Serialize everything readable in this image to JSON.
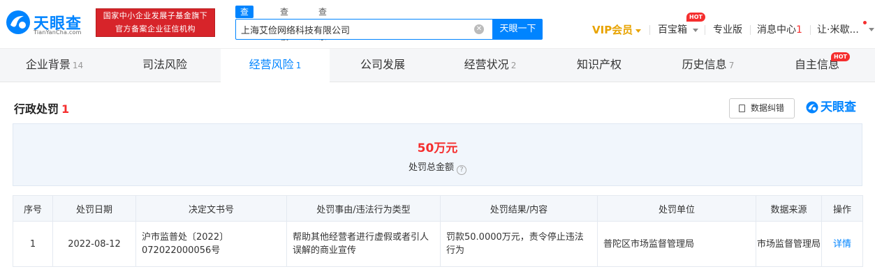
{
  "header": {
    "logo_text": "天眼查",
    "logo_sub": "TianYanCha.com",
    "banner_line1": "国家中小企业发展子基金旗下",
    "banner_line2": "官方备案企业征信机构",
    "search_tabs": [
      "查公司",
      "查老板",
      "查关系"
    ],
    "search_value": "上海艾俭网络科技有限公司",
    "search_button": "天眼一下",
    "vip_label": "VIP会员",
    "treasure_label": "百宝箱",
    "hot_badge": "HOT",
    "pro_label": "专业版",
    "msg_label": "消息中心",
    "msg_count": "1",
    "user_label": "让·米歇..."
  },
  "tabs": [
    {
      "label": "企业背景",
      "count": "14"
    },
    {
      "label": "司法风险",
      "count": ""
    },
    {
      "label": "经营风险",
      "count": "1"
    },
    {
      "label": "公司发展",
      "count": ""
    },
    {
      "label": "经营状况",
      "count": "2"
    },
    {
      "label": "知识产权",
      "count": ""
    },
    {
      "label": "历史信息",
      "count": "7"
    },
    {
      "label": "自主信息",
      "count": ""
    }
  ],
  "tabs_hot_badge": "HOT",
  "section": {
    "title": "行政处罚",
    "count": "1",
    "report_button": "数据纠错",
    "watermark": "天眼查",
    "total_value": "50万元",
    "total_label": "处罚总金额",
    "help_glyph": "?"
  },
  "table": {
    "headers": [
      "序号",
      "处罚日期",
      "决定文书号",
      "处罚事由/违法行为类型",
      "处罚结果/内容",
      "处罚单位",
      "数据来源",
      "操作"
    ],
    "rows": [
      {
        "index": "1",
        "date": "2022-08-12",
        "doc_no": "沪市监普处〔2022〕072022000056号",
        "reason": "帮助其他经营者进行虚假或者引人误解的商业宣传",
        "result": "罚款50.0000万元，责令停止违法行为",
        "authority": "普陀区市场监督管理局",
        "source": "市场监督管理局",
        "action": "详情"
      }
    ]
  },
  "colors": {
    "accent": "#0084ff",
    "alert": "#f52e2e",
    "vip": "#e8a300",
    "banner": "#d7242a"
  },
  "icons": [
    "logo-icon",
    "clear-icon",
    "chevron-down-icon",
    "document-icon",
    "help-icon"
  ]
}
